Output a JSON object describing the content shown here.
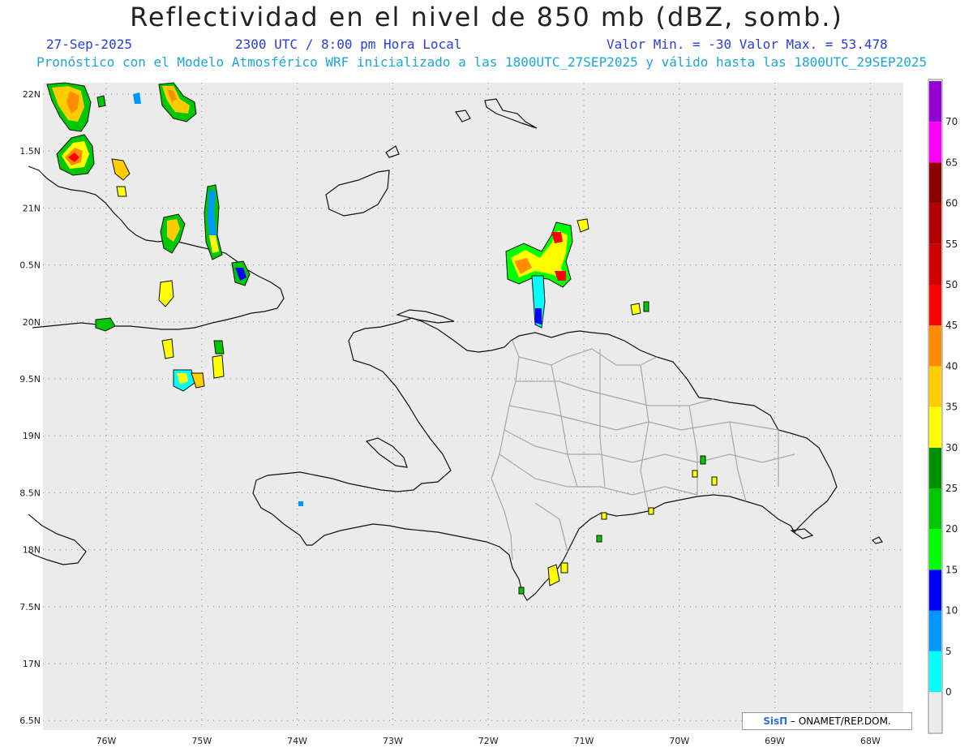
{
  "title": "Reflectividad en el nivel de 850 mb (dBZ, somb.)",
  "date": "27-Sep-2025",
  "time": "2300 UTC / 8:00 pm Hora Local",
  "minmax": "Valor Min. = -30  Valor Max. = 53.478",
  "forecast": "Pronóstico con el Modelo Atmosférico WRF inicializado a las 1800UTC_27SEP2025 y válido hasta las  1800UTC_29SEP2025",
  "credit": {
    "logo": "SisΠ",
    "text": "– ONAMET/REP.DOM."
  },
  "lat_labels": [
    "22N",
    "1.5N",
    "21N",
    "0.5N",
    "20N",
    "9.5N",
    "19N",
    "8.5N",
    "18N",
    "7.5N",
    "17N",
    "6.5N"
  ],
  "lon_labels": [
    "76W",
    "75W",
    "74W",
    "73W",
    "72W",
    "71W",
    "70W",
    "69W",
    "68W"
  ],
  "colorbar": {
    "labels": [
      "0",
      "5",
      "10",
      "15",
      "20",
      "25",
      "30",
      "35",
      "40",
      "45",
      "50",
      "55",
      "60",
      "65",
      "70"
    ],
    "colors": [
      "#00ffff",
      "#0096ff",
      "#0000ff",
      "#00ff00",
      "#00c800",
      "#009000",
      "#ffff00",
      "#ffcc00",
      "#ff8c00",
      "#ff0000",
      "#d00000",
      "#b00000",
      "#8b0000",
      "#ff00ff",
      "#9400d3"
    ]
  },
  "colors": {
    "map_background": "#ebebeb",
    "coastline": "#111111",
    "province_border": "#a8a8a8",
    "grid": "#888888"
  }
}
